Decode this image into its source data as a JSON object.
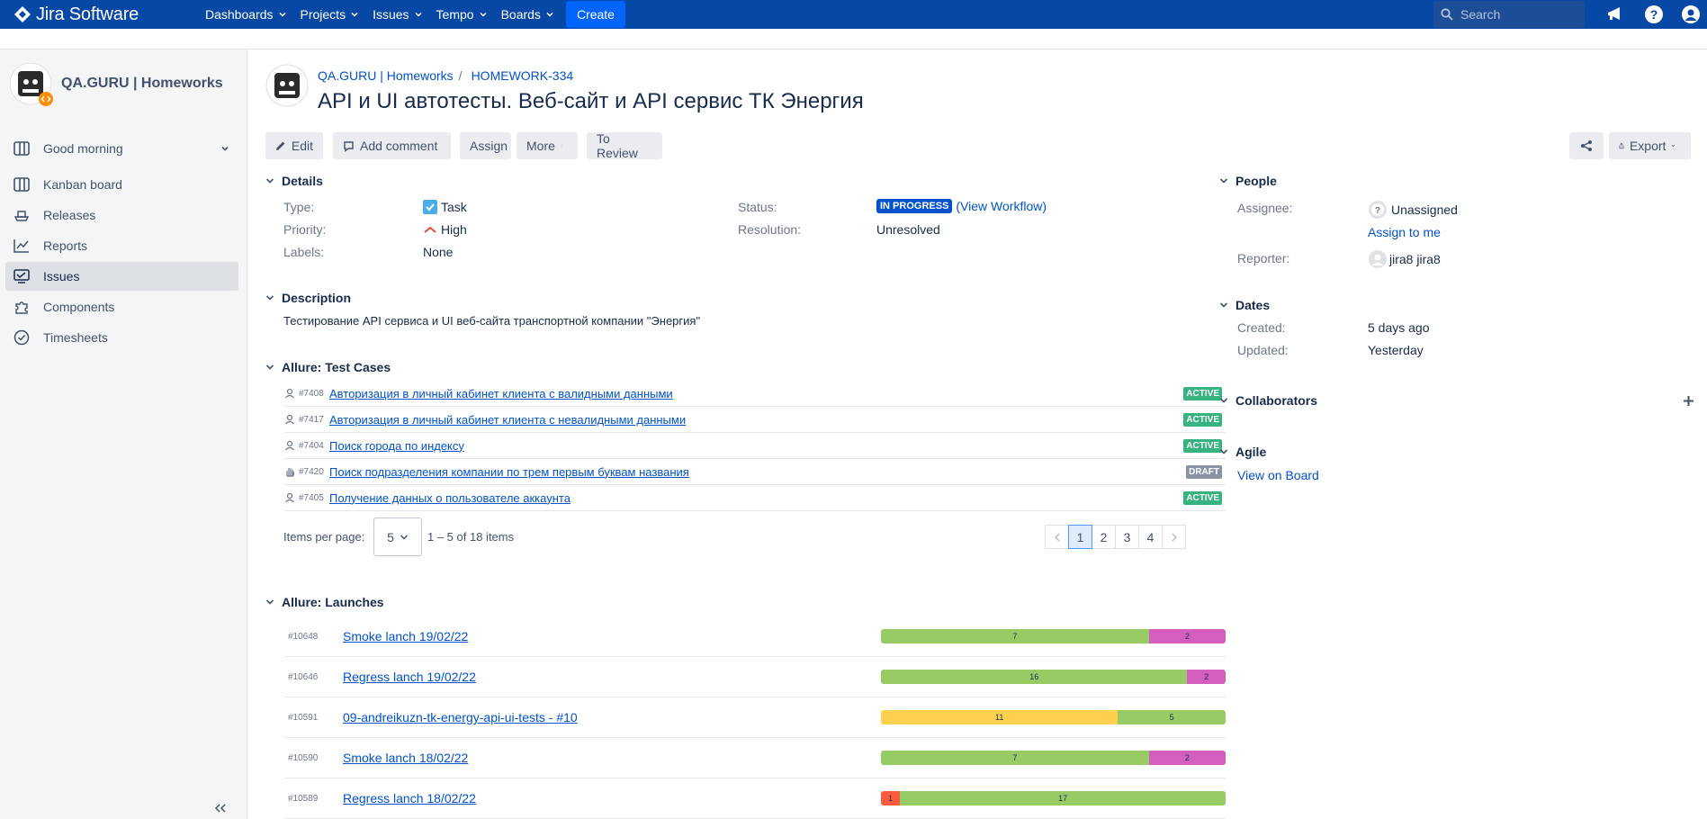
{
  "topnav": {
    "brand": "Jira Software",
    "menus": [
      "Dashboards",
      "Projects",
      "Issues",
      "Tempo",
      "Boards"
    ],
    "create_label": "Create",
    "search_placeholder": "Search"
  },
  "sidebar": {
    "project_name": "QA.GURU | Homeworks",
    "items": [
      {
        "label": "Good morning",
        "icon": "board-icon"
      },
      {
        "label": "Kanban board",
        "icon": "board-icon"
      },
      {
        "label": "Releases",
        "icon": "ship-icon"
      },
      {
        "label": "Reports",
        "icon": "chart-icon"
      },
      {
        "label": "Issues",
        "icon": "issues-icon"
      },
      {
        "label": "Components",
        "icon": "puzzle-icon"
      },
      {
        "label": "Timesheets",
        "icon": "clock-icon"
      }
    ],
    "active_index": 4
  },
  "issue": {
    "breadcrumb_project": "QA.GURU | Homeworks",
    "breadcrumb_sep": "/",
    "breadcrumb_key": "HOMEWORK-334",
    "title": "API и UI автотесты. Веб-сайт и API сервис ТК Энергия"
  },
  "toolbar": {
    "edit": "Edit",
    "comment": "Add comment",
    "assign": "Assign",
    "more": "More",
    "review": "To Review",
    "export": "Export"
  },
  "details": {
    "heading": "Details",
    "type_label": "Type:",
    "type_value": "Task",
    "priority_label": "Priority:",
    "priority_value": "High",
    "labels_label": "Labels:",
    "labels_value": "None",
    "status_label": "Status:",
    "status_value": "IN PROGRESS",
    "workflow_link": "(View Workflow)",
    "resolution_label": "Resolution:",
    "resolution_value": "Unresolved"
  },
  "description": {
    "heading": "Description",
    "text": "Тестирование API сервиса и UI веб-сайта транспортной компании \"Энергия\""
  },
  "testcases": {
    "heading": "Allure: Test Cases",
    "rows": [
      {
        "id": "#7408",
        "name": "Авторизация в личный кабинет клиента с валидными данными",
        "status": "ACTIVE"
      },
      {
        "id": "#7417",
        "name": "Авторизация в личный кабинет клиента с невалидными данными",
        "status": "ACTIVE"
      },
      {
        "id": "#7404",
        "name": "Поиск города по индексу",
        "status": "ACTIVE"
      },
      {
        "id": "#7420",
        "name": "Поиск подразделения компании по трем первым буквам названия",
        "status": "DRAFT"
      },
      {
        "id": "#7405",
        "name": "Получение данных о пользователе аккаунта",
        "status": "ACTIVE"
      }
    ],
    "items_per_page_label": "Items per page:",
    "per_page": "5",
    "range_text": "1 – 5 of 18 items",
    "pages": [
      "1",
      "2",
      "3",
      "4"
    ],
    "current_page": 1
  },
  "launches": {
    "heading": "Allure: Launches",
    "rows": [
      {
        "id": "#10648",
        "name": "Smoke lanch 19/02/22",
        "segments": [
          {
            "value": 7,
            "color": "#97cc64"
          },
          {
            "value": 2,
            "color": "#d35ebe"
          }
        ]
      },
      {
        "id": "#10646",
        "name": "Regress lanch 19/02/22",
        "segments": [
          {
            "value": 16,
            "color": "#97cc64"
          },
          {
            "value": 2,
            "color": "#d35ebe"
          }
        ]
      },
      {
        "id": "#10591",
        "name": "09-andreikuzn-tk-energy-api-ui-tests - #10",
        "segments": [
          {
            "value": 11,
            "color": "#ffd050"
          },
          {
            "value": 5,
            "color": "#97cc64"
          }
        ]
      },
      {
        "id": "#10590",
        "name": "Smoke lanch 18/02/22",
        "segments": [
          {
            "value": 7,
            "color": "#97cc64"
          },
          {
            "value": 2,
            "color": "#d35ebe"
          }
        ]
      },
      {
        "id": "#10589",
        "name": "Regress lanch 18/02/22",
        "segments": [
          {
            "value": 1,
            "color": "#fd5a3e"
          },
          {
            "value": 17,
            "color": "#97cc64"
          }
        ]
      }
    ]
  },
  "people": {
    "heading": "People",
    "assignee_label": "Assignee:",
    "assignee_value": "Unassigned",
    "assign_to_me": "Assign to me",
    "reporter_label": "Reporter:",
    "reporter_value": "jira8 jira8"
  },
  "dates": {
    "heading": "Dates",
    "created_label": "Created:",
    "created_value": "5 days ago",
    "updated_label": "Updated:",
    "updated_value": "Yesterday"
  },
  "collaborators": {
    "heading": "Collaborators"
  },
  "agile": {
    "heading": "Agile",
    "link": "View on Board"
  },
  "colors": {
    "nav": "#0747a6",
    "link": "#0052cc",
    "active": "#36b37e",
    "draft": "#8993a4"
  }
}
